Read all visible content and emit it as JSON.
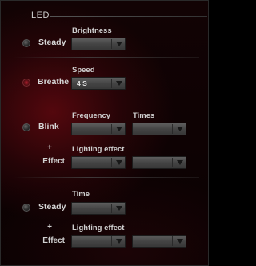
{
  "section": {
    "title": "LED"
  },
  "steady": {
    "option_label": "Steady",
    "brightness_label": "Brightness",
    "brightness_value": ""
  },
  "breathe": {
    "option_label": "Breathe",
    "speed_label": "Speed",
    "speed_value": "4 S"
  },
  "blink": {
    "option_label": "Blink",
    "frequency_label": "Frequency",
    "frequency_value": "",
    "times_label": "Times",
    "times_value": "",
    "plus": "+",
    "effect_label": "Effect",
    "lighting_effect_label": "Lighting effect",
    "lighting_effect_value": "",
    "lighting_effect_color_value": ""
  },
  "steady_time": {
    "option_label": "Steady",
    "time_label": "Time",
    "time_value": "",
    "plus": "+",
    "effect_label": "Effect",
    "lighting_effect_label": "Lighting effect",
    "lighting_effect_value": "",
    "lighting_effect_color_value": ""
  },
  "colors": {
    "selected_radio": "#b02030",
    "background_glow": "#8c0c16"
  }
}
